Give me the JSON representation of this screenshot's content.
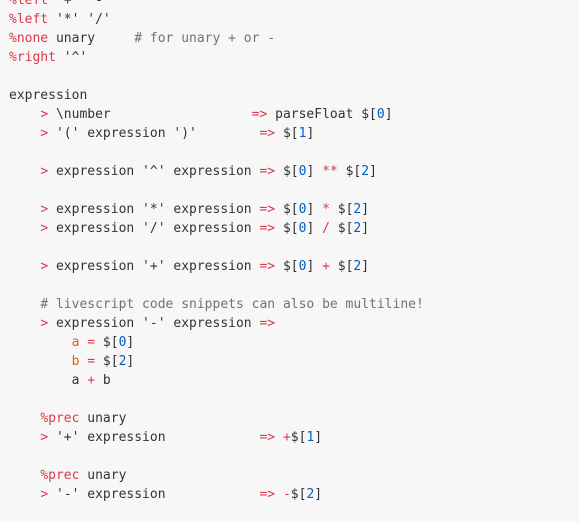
{
  "editor": {
    "colors": {
      "background": "#f7f7f7",
      "plain": "#333333",
      "keyword": "#d73a49",
      "operator": "#d73a49",
      "number": "#005cc5",
      "comment": "#6a737d",
      "variable": "#e36209"
    },
    "lines": [
      [
        {
          "t": "keyword",
          "v": "%left"
        },
        {
          "t": "plain",
          "v": " '+' '-'"
        }
      ],
      [
        {
          "t": "keyword",
          "v": "%left"
        },
        {
          "t": "plain",
          "v": " '*' '/'"
        }
      ],
      [
        {
          "t": "keyword",
          "v": "%none"
        },
        {
          "t": "plain",
          "v": " unary     "
        },
        {
          "t": "comment",
          "v": "# for unary + or -"
        }
      ],
      [
        {
          "t": "keyword",
          "v": "%right"
        },
        {
          "t": "plain",
          "v": " '^'"
        }
      ],
      [],
      [
        {
          "t": "plain",
          "v": "expression"
        }
      ],
      [
        {
          "t": "plain",
          "v": "    "
        },
        {
          "t": "operator",
          "v": ">"
        },
        {
          "t": "plain",
          "v": " \\number                  "
        },
        {
          "t": "operator",
          "v": "=>"
        },
        {
          "t": "plain",
          "v": " parseFloat $["
        },
        {
          "t": "number",
          "v": "0"
        },
        {
          "t": "plain",
          "v": "]"
        }
      ],
      [
        {
          "t": "plain",
          "v": "    "
        },
        {
          "t": "operator",
          "v": ">"
        },
        {
          "t": "plain",
          "v": " '(' expression ')'        "
        },
        {
          "t": "operator",
          "v": "=>"
        },
        {
          "t": "plain",
          "v": " $["
        },
        {
          "t": "number",
          "v": "1"
        },
        {
          "t": "plain",
          "v": "]"
        }
      ],
      [],
      [
        {
          "t": "plain",
          "v": "    "
        },
        {
          "t": "operator",
          "v": ">"
        },
        {
          "t": "plain",
          "v": " expression '^' expression "
        },
        {
          "t": "operator",
          "v": "=>"
        },
        {
          "t": "plain",
          "v": " $["
        },
        {
          "t": "number",
          "v": "0"
        },
        {
          "t": "plain",
          "v": "] "
        },
        {
          "t": "operator",
          "v": "**"
        },
        {
          "t": "plain",
          "v": " $["
        },
        {
          "t": "number",
          "v": "2"
        },
        {
          "t": "plain",
          "v": "]"
        }
      ],
      [],
      [
        {
          "t": "plain",
          "v": "    "
        },
        {
          "t": "operator",
          "v": ">"
        },
        {
          "t": "plain",
          "v": " expression '*' expression "
        },
        {
          "t": "operator",
          "v": "=>"
        },
        {
          "t": "plain",
          "v": " $["
        },
        {
          "t": "number",
          "v": "0"
        },
        {
          "t": "plain",
          "v": "] "
        },
        {
          "t": "operator",
          "v": "*"
        },
        {
          "t": "plain",
          "v": " $["
        },
        {
          "t": "number",
          "v": "2"
        },
        {
          "t": "plain",
          "v": "]"
        }
      ],
      [
        {
          "t": "plain",
          "v": "    "
        },
        {
          "t": "operator",
          "v": ">"
        },
        {
          "t": "plain",
          "v": " expression '/' expression "
        },
        {
          "t": "operator",
          "v": "=>"
        },
        {
          "t": "plain",
          "v": " $["
        },
        {
          "t": "number",
          "v": "0"
        },
        {
          "t": "plain",
          "v": "] "
        },
        {
          "t": "operator",
          "v": "/"
        },
        {
          "t": "plain",
          "v": " $["
        },
        {
          "t": "number",
          "v": "2"
        },
        {
          "t": "plain",
          "v": "]"
        }
      ],
      [],
      [
        {
          "t": "plain",
          "v": "    "
        },
        {
          "t": "operator",
          "v": ">"
        },
        {
          "t": "plain",
          "v": " expression '+' expression "
        },
        {
          "t": "operator",
          "v": "=>"
        },
        {
          "t": "plain",
          "v": " $["
        },
        {
          "t": "number",
          "v": "0"
        },
        {
          "t": "plain",
          "v": "] "
        },
        {
          "t": "operator",
          "v": "+"
        },
        {
          "t": "plain",
          "v": " $["
        },
        {
          "t": "number",
          "v": "2"
        },
        {
          "t": "plain",
          "v": "]"
        }
      ],
      [],
      [
        {
          "t": "plain",
          "v": "    "
        },
        {
          "t": "comment",
          "v": "# livescript code snippets can also be multiline!"
        }
      ],
      [
        {
          "t": "plain",
          "v": "    "
        },
        {
          "t": "operator",
          "v": ">"
        },
        {
          "t": "plain",
          "v": " expression '-' expression "
        },
        {
          "t": "operator",
          "v": "=>"
        }
      ],
      [
        {
          "t": "plain",
          "v": "        "
        },
        {
          "t": "variable",
          "v": "a"
        },
        {
          "t": "plain",
          "v": " "
        },
        {
          "t": "operator",
          "v": "="
        },
        {
          "t": "plain",
          "v": " $["
        },
        {
          "t": "number",
          "v": "0"
        },
        {
          "t": "plain",
          "v": "]"
        }
      ],
      [
        {
          "t": "plain",
          "v": "        "
        },
        {
          "t": "variable",
          "v": "b"
        },
        {
          "t": "plain",
          "v": " "
        },
        {
          "t": "operator",
          "v": "="
        },
        {
          "t": "plain",
          "v": " $["
        },
        {
          "t": "number",
          "v": "2"
        },
        {
          "t": "plain",
          "v": "]"
        }
      ],
      [
        {
          "t": "plain",
          "v": "        a "
        },
        {
          "t": "operator",
          "v": "+"
        },
        {
          "t": "plain",
          "v": " b"
        }
      ],
      [],
      [
        {
          "t": "plain",
          "v": "    "
        },
        {
          "t": "keyword",
          "v": "%prec"
        },
        {
          "t": "plain",
          "v": " unary"
        }
      ],
      [
        {
          "t": "plain",
          "v": "    "
        },
        {
          "t": "operator",
          "v": ">"
        },
        {
          "t": "plain",
          "v": " '+' expression            "
        },
        {
          "t": "operator",
          "v": "=>"
        },
        {
          "t": "plain",
          "v": " "
        },
        {
          "t": "operator",
          "v": "+"
        },
        {
          "t": "plain",
          "v": "$["
        },
        {
          "t": "number",
          "v": "1"
        },
        {
          "t": "plain",
          "v": "]"
        }
      ],
      [],
      [
        {
          "t": "plain",
          "v": "    "
        },
        {
          "t": "keyword",
          "v": "%prec"
        },
        {
          "t": "plain",
          "v": " unary"
        }
      ],
      [
        {
          "t": "plain",
          "v": "    "
        },
        {
          "t": "operator",
          "v": ">"
        },
        {
          "t": "plain",
          "v": " '-' expression            "
        },
        {
          "t": "operator",
          "v": "=>"
        },
        {
          "t": "plain",
          "v": " "
        },
        {
          "t": "operator",
          "v": "-"
        },
        {
          "t": "plain",
          "v": "$["
        },
        {
          "t": "number",
          "v": "2"
        },
        {
          "t": "plain",
          "v": "]"
        }
      ]
    ]
  }
}
